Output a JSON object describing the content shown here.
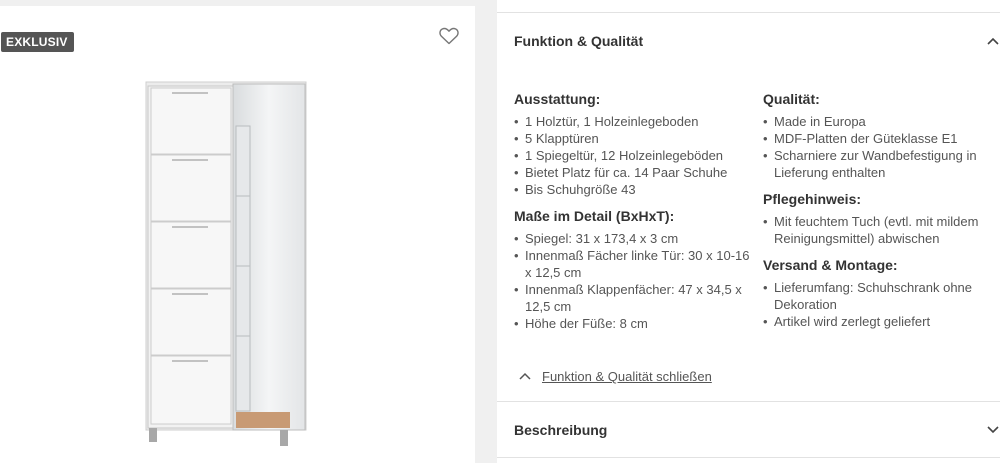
{
  "badge": "EXKLUSIV",
  "icons": {
    "wishlist": "heart-icon",
    "collapse": "chevron-up-icon",
    "expand": "chevron-down-icon"
  },
  "accordion": {
    "title": "Funktion & Qualität",
    "close_label": "Funktion & Qualität schließen",
    "columns": [
      {
        "sections": [
          {
            "heading": "Ausstattung:",
            "items": [
              "1 Holztür, 1 Holzeinlegeboden",
              "5 Klapptüren",
              "1 Spiegeltür, 12 Holzeinlegeböden",
              "Bietet Platz für ca. 14 Paar Schuhe",
              "Bis Schuhgröße 43"
            ]
          },
          {
            "heading": "Maße im Detail (BxHxT):",
            "items": [
              "Spiegel: 31 x 173,4 x 3 cm",
              "Innenmaß Fächer linke Tür: 30 x 10-16 x 12,5 cm",
              "Innenmaß Klappenfächer: 47 x 34,5 x 12,5 cm",
              "Höhe der Füße: 8 cm"
            ]
          }
        ]
      },
      {
        "sections": [
          {
            "heading": "Qualität:",
            "items": [
              "Made in Europa",
              "MDF-Platten der Güteklasse E1",
              "Scharniere zur Wandbefestigung in Lieferung enthalten"
            ]
          },
          {
            "heading": "Pflegehinweis:",
            "items": [
              "Mit feuchtem Tuch (evtl. mit mildem Reinigungsmittel) abwischen"
            ]
          },
          {
            "heading": "Versand & Montage:",
            "items": [
              "Lieferumfang: Schuhschrank ohne Dekoration",
              "Artikel wird zerlegt geliefert"
            ]
          }
        ]
      }
    ]
  },
  "description": {
    "title": "Beschreibung"
  }
}
